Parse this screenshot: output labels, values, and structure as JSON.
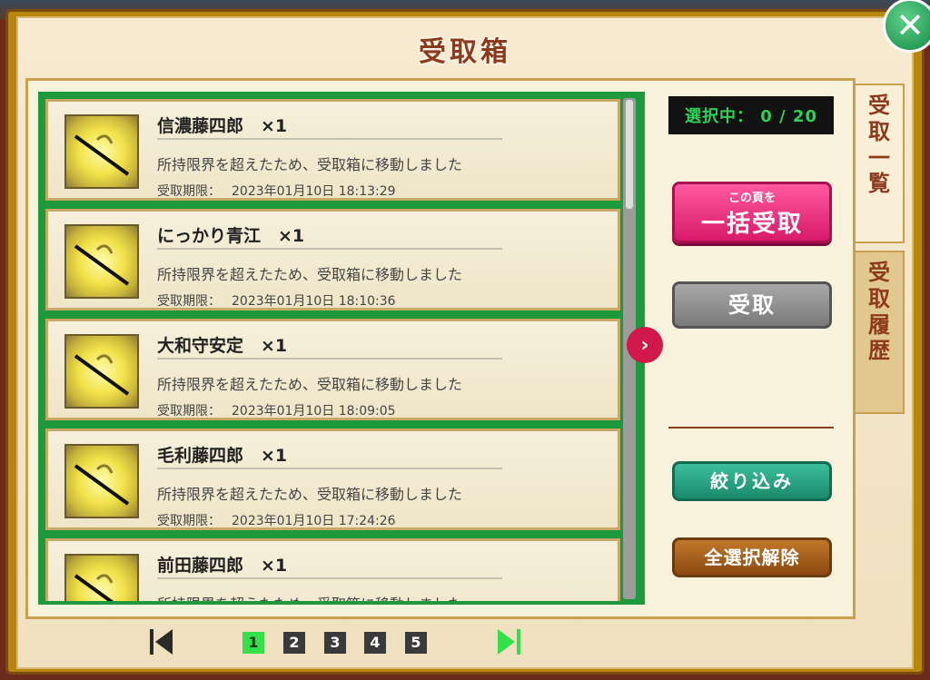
{
  "dialog": {
    "title": "受取箱"
  },
  "items": [
    {
      "name": "信濃藤四郎　×1",
      "desc": "所持限界を超えたため、受取箱に移動しました",
      "date_label": "受取期限：",
      "date": "2023年01月10日 18:13:29"
    },
    {
      "name": "にっかり青江　×1",
      "desc": "所持限界を超えたため、受取箱に移動しました",
      "date_label": "受取期限：",
      "date": "2023年01月10日 18:10:36"
    },
    {
      "name": "大和守安定　×1",
      "desc": "所持限界を超えたため、受取箱に移動しました",
      "date_label": "受取期限：",
      "date": "2023年01月10日 18:09:05"
    },
    {
      "name": "毛利藤四郎　×1",
      "desc": "所持限界を超えたため、受取箱に移動しました",
      "date_label": "受取期限：",
      "date": "2023年01月10日 17:24:26"
    },
    {
      "name": "前田藤四郎　×1",
      "desc": "所持限界を超えたため、受取箱に移動しました",
      "date_label": "",
      "date": ""
    }
  ],
  "sidebar": {
    "selected_counter": "選択中： 0 / 20",
    "bulk_small": "この頁を",
    "bulk_big": "一括受取",
    "receive": "受取",
    "filter": "絞り込み",
    "deselect_all": "全選択解除"
  },
  "tabs": {
    "list": [
      "受",
      "取",
      "一",
      "覧"
    ],
    "history": [
      "受",
      "取",
      "履",
      "歴"
    ]
  },
  "pagination": {
    "pages": [
      "1",
      "2",
      "3",
      "4",
      "5"
    ],
    "current": "1"
  },
  "colors": {
    "accent_green": "#1e9a3c",
    "bulk_pink": "#d81a6a",
    "title_brown": "#8b3a1c"
  }
}
